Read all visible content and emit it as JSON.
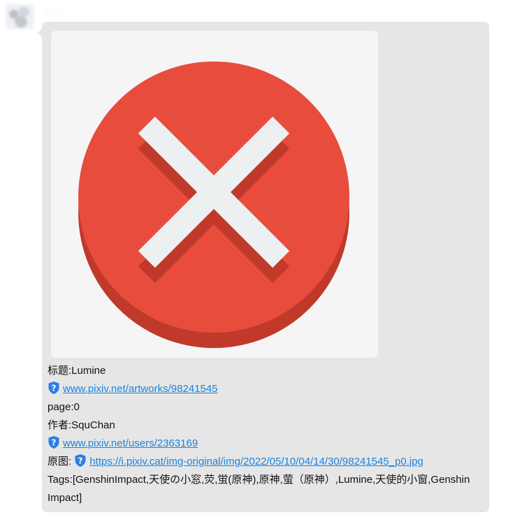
{
  "sender": {
    "name": "······"
  },
  "message": {
    "image": {
      "icon": "error-x-icon",
      "colors": {
        "circle": "#e84c3d",
        "circle_shadow": "#c0392b",
        "cross": "#ecf0f1",
        "card_bg": "#f5f5f5"
      }
    },
    "title_line": "标题:Lumine",
    "artwork_link": "www.pixiv.net/artworks/98241545",
    "page_line": "page:0",
    "author_line": "作者:SquChan",
    "author_link": "www.pixiv.net/users/2363169",
    "original_label": "原图:",
    "original_link": "https://i.pixiv.cat/img-original/img/2022/05/10/04/14/30/98241545_p0.jpg",
    "tags_line": "Tags:[GenshinImpact,天使の小窓,荧,蛍(原神),原神,萤（原神）,Lumine,天使的小窗,Genshin Impact]",
    "link_color": "#1a83e0",
    "bubble_color": "#e6e6e6"
  }
}
